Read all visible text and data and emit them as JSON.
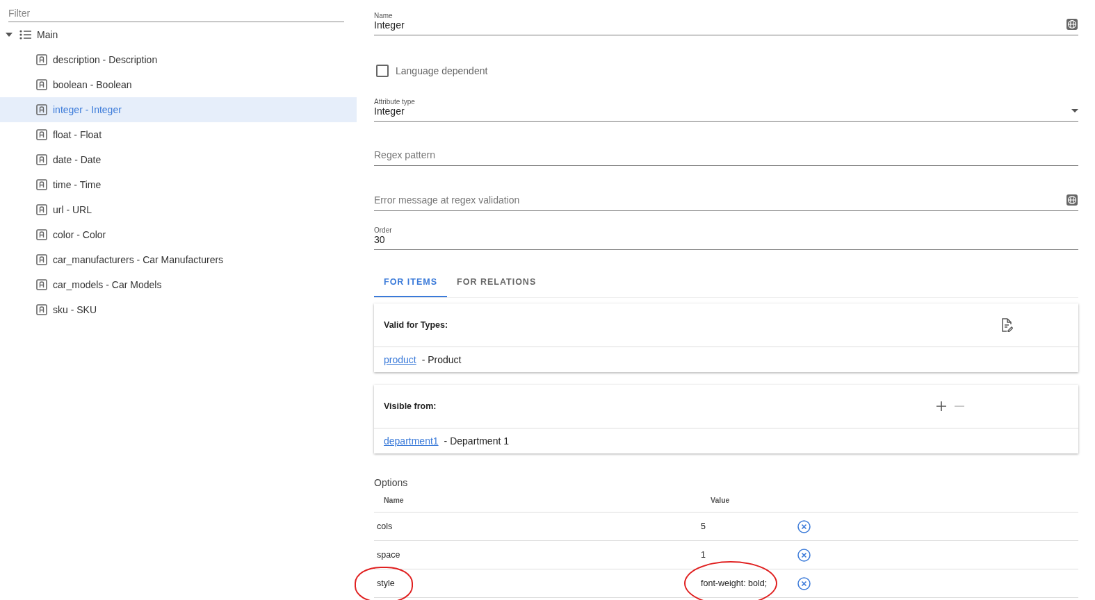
{
  "sidebar": {
    "filter": {
      "placeholder": "Filter"
    },
    "tree": [
      {
        "label": "Main",
        "expanded": true,
        "selected": false,
        "children": [
          {
            "label": "description - Description",
            "selected": false
          },
          {
            "label": "boolean - Boolean",
            "selected": false
          },
          {
            "label": "integer - Integer",
            "selected": true
          },
          {
            "label": "float - Float",
            "selected": false
          },
          {
            "label": "date - Date",
            "selected": false
          },
          {
            "label": "time - Time",
            "selected": false
          },
          {
            "label": "url - URL",
            "selected": false
          },
          {
            "label": "color - Color",
            "selected": false
          },
          {
            "label": "car_manufacturers - Car Manufacturers",
            "selected": false
          },
          {
            "label": "car_models - Car Models",
            "selected": false
          },
          {
            "label": "sku - SKU",
            "selected": false
          }
        ]
      }
    ]
  },
  "form": {
    "name": {
      "label": "Name",
      "value": "Integer"
    },
    "language_dependent": {
      "label": "Language dependent",
      "checked": false
    },
    "attribute_type": {
      "label": "Attribute type",
      "value": "Integer"
    },
    "regex_pattern": {
      "placeholder": "Regex pattern"
    },
    "error_message": {
      "placeholder": "Error message at regex validation"
    },
    "order": {
      "label": "Order",
      "value": "30"
    }
  },
  "tabs": [
    {
      "label": "FOR ITEMS",
      "selected": true
    },
    {
      "label": "FOR RELATIONS",
      "selected": false
    }
  ],
  "cards": [
    {
      "kind": "edit",
      "title": "Valid for Types:",
      "rows": [
        {
          "link": "product",
          "text": "- Product"
        }
      ]
    },
    {
      "kind": "addremove",
      "title": "Visible from:",
      "rows": [
        {
          "link": "department1",
          "text": "- Department 1"
        }
      ]
    }
  ],
  "options": {
    "title": "Options",
    "columns": [
      "Name",
      "Value"
    ],
    "rows": [
      {
        "name": "cols",
        "value": "5",
        "circled": false
      },
      {
        "name": "space",
        "value": "1",
        "circled": false
      },
      {
        "name": "style",
        "value": "font-weight: bold;",
        "circled": true
      }
    ]
  }
}
